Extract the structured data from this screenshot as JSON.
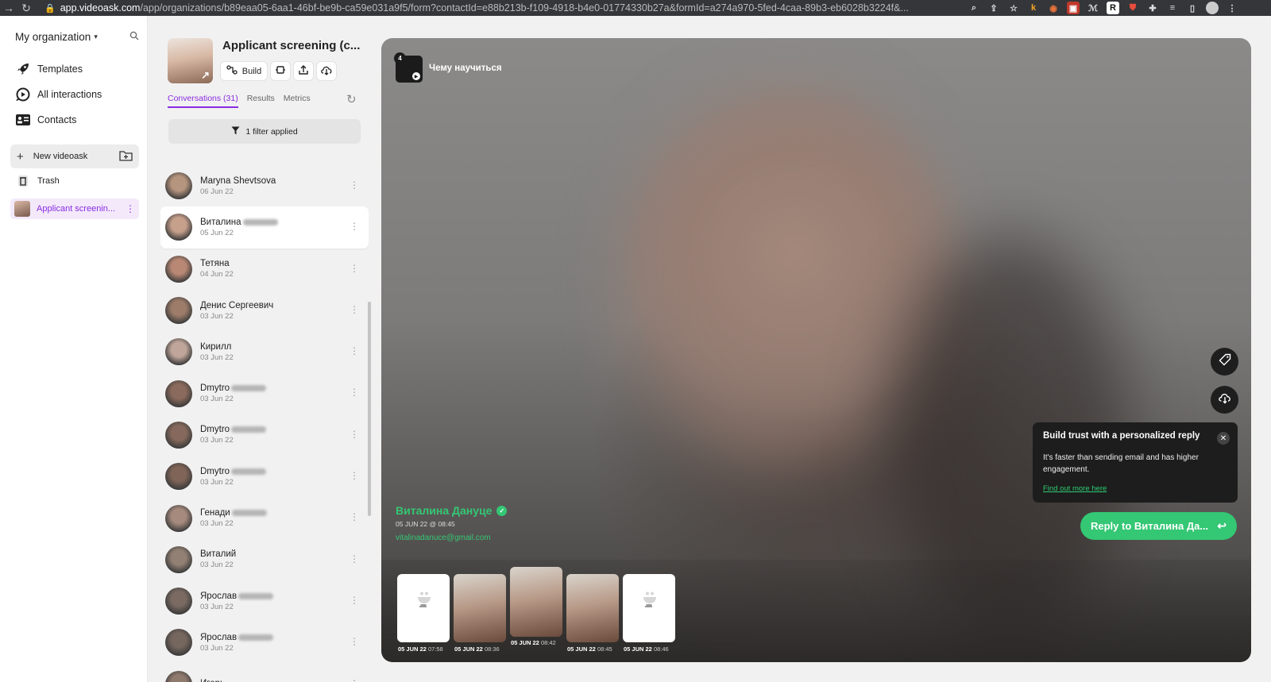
{
  "browser": {
    "url_host": "app.videoask.com",
    "url_path": "/app/organizations/b89eaa05-6aa1-46bf-be9b-ca59e031a9f5/form?contactId=e88b213b-f109-4918-b4e0-01774330b27a&formId=a274a970-5fed-4caa-89b3-eb6028b3224f&..."
  },
  "sidebar": {
    "org_name": "My organization",
    "nav": [
      {
        "label": "Templates",
        "icon": "rocket-icon"
      },
      {
        "label": "All interactions",
        "icon": "play-bubble-icon"
      },
      {
        "label": "Contacts",
        "icon": "contacts-icon"
      }
    ],
    "new_videoask": "New videoask",
    "trash": "Trash",
    "active_form": "Applicant screenin..."
  },
  "panel": {
    "title": "Applicant screening (c...",
    "build_label": "Build",
    "tabs": [
      "Conversations (31)",
      "Results",
      "Metrics"
    ],
    "filter_label": "1 filter applied",
    "conversations": [
      {
        "name": "Maryna Shevtsova",
        "date": "06 Jun 22",
        "blurred": false,
        "skin": "#b6957e"
      },
      {
        "name": "Виталина",
        "date": "05 Jun 22",
        "blurred": true,
        "skin": "#c7a08c"
      },
      {
        "name": "Тетяна",
        "date": "04 Jun 22",
        "blurred": false,
        "skin": "#b88874"
      },
      {
        "name": "Денис Сергеевич",
        "date": "03 Jun 22",
        "blurred": false,
        "skin": "#9d7c6a"
      },
      {
        "name": "Кирилл",
        "date": "03 Jun 22",
        "blurred": false,
        "skin": "#c0a69a"
      },
      {
        "name": "Dmytro",
        "date": "03 Jun 22",
        "blurred": true,
        "skin": "#8a6a5c"
      },
      {
        "name": "Dmytro",
        "date": "03 Jun 22",
        "blurred": true,
        "skin": "#86695c"
      },
      {
        "name": "Dmytro",
        "date": "03 Jun 22",
        "blurred": true,
        "skin": "#7f6457"
      },
      {
        "name": "Генади",
        "date": "03 Jun 22",
        "blurred": true,
        "skin": "#a58a7d"
      },
      {
        "name": "Виталий",
        "date": "03 Jun 22",
        "blurred": false,
        "skin": "#928074"
      },
      {
        "name": "Ярослав",
        "date": "03 Jun 22",
        "blurred": true,
        "skin": "#7a6a62"
      },
      {
        "name": "Ярослав",
        "date": "03 Jun 22",
        "blurred": true,
        "skin": "#75665e"
      },
      {
        "name": "Игорь",
        "date": "",
        "blurred": false,
        "skin": "#8f7a6e"
      }
    ]
  },
  "video": {
    "step_number": "4",
    "step_title": "Чему научиться",
    "contact_name": "Виталина Дануце",
    "contact_time": "05 JUN 22 @ 08:45",
    "contact_email": "vitalinadanuce@gmail.com",
    "tooltip": {
      "title": "Build trust with a personalized reply",
      "body": "It's faster than sending email and has higher engagement.",
      "link": "Find out more here"
    },
    "reply_label": "Reply to Виталина Да...",
    "filmstrip": [
      {
        "type": "placeholder",
        "day": "05 JUN 22",
        "time": "07:58"
      },
      {
        "type": "video",
        "day": "05 JUN 22",
        "time": "08:36"
      },
      {
        "type": "video",
        "day": "05 JUN 22",
        "time": "08:42",
        "selected": true
      },
      {
        "type": "video",
        "day": "05 JUN 22",
        "time": "08:45"
      },
      {
        "type": "placeholder",
        "day": "05 JUN 22",
        "time": "08:46"
      }
    ]
  },
  "colors": {
    "accent": "#8a2be2",
    "green": "#34c774"
  }
}
